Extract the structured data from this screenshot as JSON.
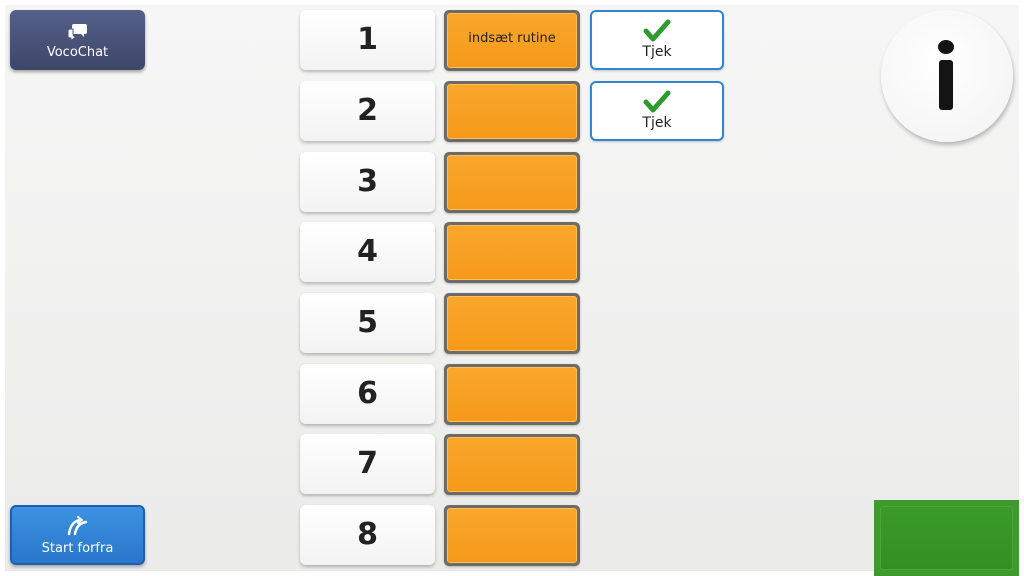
{
  "app": {
    "vocochat": {
      "label": "VocoChat",
      "icon": "chat-bubbles-icon"
    },
    "restart": {
      "label": "Start forfra",
      "icon": "restart-arrow-icon"
    },
    "info": {
      "icon": "info-icon"
    },
    "green_button": {
      "label": ""
    }
  },
  "rows": [
    {
      "number": "1",
      "slot_text": "indsæt rutine",
      "check_label": "Tjek"
    },
    {
      "number": "2",
      "slot_text": "",
      "check_label": "Tjek"
    },
    {
      "number": "3",
      "slot_text": ""
    },
    {
      "number": "4",
      "slot_text": ""
    },
    {
      "number": "5",
      "slot_text": ""
    },
    {
      "number": "6",
      "slot_text": ""
    },
    {
      "number": "7",
      "slot_text": ""
    },
    {
      "number": "8",
      "slot_text": ""
    }
  ],
  "colors": {
    "slot_orange": "#f7a024",
    "check_green": "#2e9b2e",
    "check_border_blue": "#2f86d3",
    "vocochat_navy": "#4a5478",
    "restart_blue": "#3386d8",
    "info_black": "#141414",
    "bottom_green": "#3e9a2d"
  }
}
